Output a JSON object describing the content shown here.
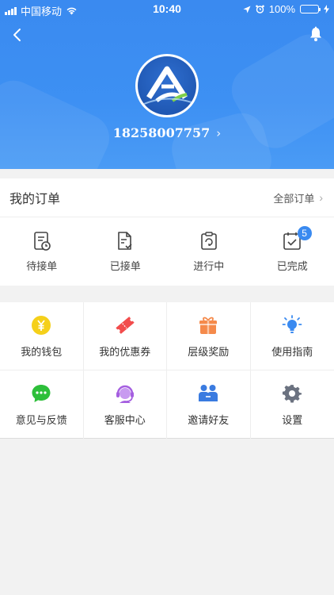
{
  "status_bar": {
    "carrier": "中国移动",
    "time": "10:40",
    "battery": "100%"
  },
  "profile": {
    "phone": "18258007757",
    "chevron": "›"
  },
  "orders": {
    "title": "我的订单",
    "all_label": "全部订单",
    "chevron": "›",
    "items": [
      {
        "label": "待接单",
        "icon": "pending-order-icon"
      },
      {
        "label": "已接单",
        "icon": "accepted-order-icon"
      },
      {
        "label": "进行中",
        "icon": "in-progress-icon"
      },
      {
        "label": "已完成",
        "icon": "completed-icon",
        "badge": "5"
      }
    ]
  },
  "menu": [
    {
      "label": "我的钱包",
      "icon": "wallet-icon",
      "color": "#f5d01a"
    },
    {
      "label": "我的优惠券",
      "icon": "coupon-icon",
      "color": "#f24c4c"
    },
    {
      "label": "层级奖励",
      "icon": "gift-icon",
      "color": "#f58a4b"
    },
    {
      "label": "使用指南",
      "icon": "lightbulb-icon",
      "color": "#3a8af0"
    },
    {
      "label": "意见与反馈",
      "icon": "feedback-icon",
      "color": "#2dbf3a"
    },
    {
      "label": "客服中心",
      "icon": "customer-service-icon",
      "color": "#a55fe0"
    },
    {
      "label": "邀请好友",
      "icon": "invite-friends-icon",
      "color": "#3a7be0"
    },
    {
      "label": "设置",
      "icon": "settings-icon",
      "color": "#6b7280"
    }
  ],
  "colors": {
    "primary": "#3a8af0",
    "badge": "#3a8af0",
    "background": "#f2f2f2"
  }
}
